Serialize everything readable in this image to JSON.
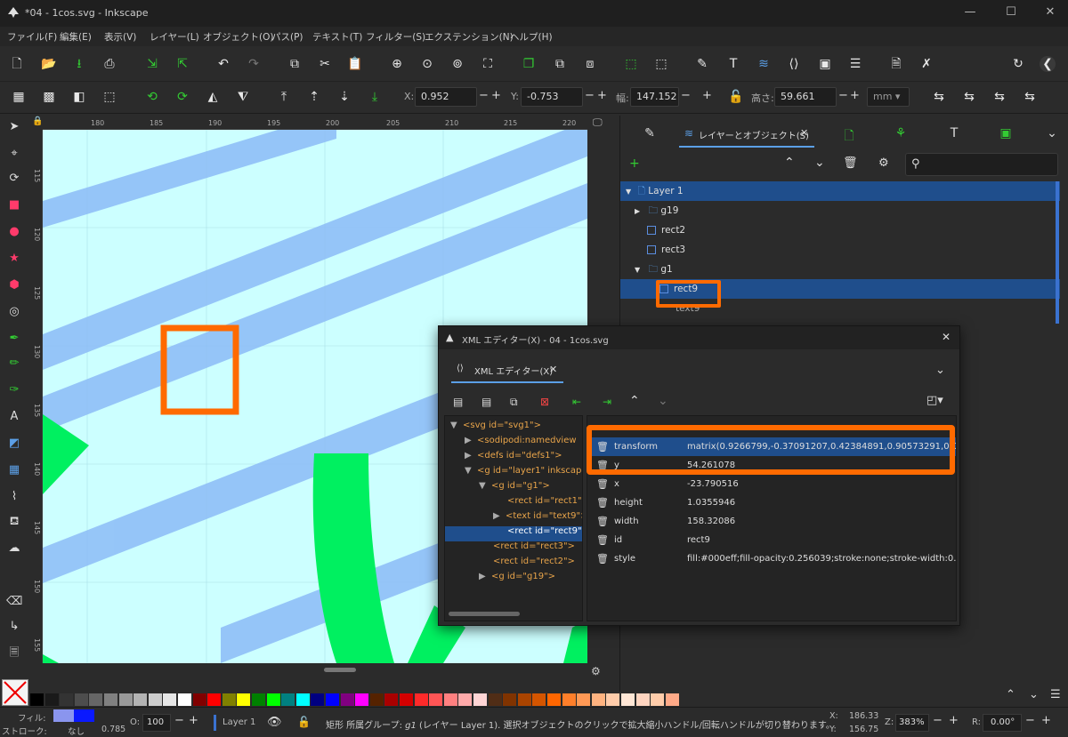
{
  "window": {
    "title": "*04 - 1cos.svg - Inkscape"
  },
  "menu": [
    "ファイル(F)",
    "編集(E)",
    "表示(V)",
    "レイヤー(L)",
    "オブジェクト(O)",
    "パス(P)",
    "テキスト(T)",
    "フィルター(S)",
    "エクステンション(N)",
    "ヘルプ(H)"
  ],
  "controls": {
    "x_label": "X:",
    "x_value": "0.952",
    "y_label": "Y:",
    "y_value": "-0.753",
    "w_label": "幅:",
    "w_value": "147.152",
    "h_label": "高さ:",
    "h_value": "59.661",
    "unit": "mm"
  },
  "ruler": {
    "h": [
      "180",
      "185",
      "190",
      "195",
      "200",
      "205",
      "210",
      "215",
      "220"
    ],
    "v": [
      "115",
      "120",
      "125",
      "130",
      "135",
      "140",
      "145",
      "150",
      "155"
    ]
  },
  "panel": {
    "tab_label": "レイヤーとオブジェクト(S)",
    "layers": [
      {
        "label": "Layer 1",
        "kind": "layer"
      },
      {
        "label": "g19",
        "kind": "group"
      },
      {
        "label": "rect2",
        "kind": "rect"
      },
      {
        "label": "rect3",
        "kind": "rect"
      },
      {
        "label": "g1",
        "kind": "group"
      },
      {
        "label": "rect9",
        "kind": "rect"
      },
      {
        "label": "text9",
        "kind": "text"
      }
    ]
  },
  "xml_editor": {
    "window_title": "XML エディター(X) - 04 - 1cos.svg",
    "tab_label": "XML エディター(X)",
    "tree": [
      {
        "text": "<svg id=\"svg1\">",
        "expander": "▼"
      },
      {
        "text": "<sodipodi:namedview",
        "expander": "▶"
      },
      {
        "text": "<defs id=\"defs1\">",
        "expander": "▶"
      },
      {
        "text": "<g id=\"layer1\" inkscap",
        "expander": "▼"
      },
      {
        "text": "<g id=\"g1\">",
        "expander": "▼"
      },
      {
        "text": "<rect id=\"rect1\">",
        "expander": ""
      },
      {
        "text": "<text id=\"text9\">",
        "expander": "▶"
      },
      {
        "text": "<rect id=\"rect9\">",
        "expander": ""
      },
      {
        "text": "<rect id=\"rect3\">",
        "expander": ""
      },
      {
        "text": "<rect id=\"rect2\">",
        "expander": ""
      },
      {
        "text": "<g id=\"g19\">",
        "expander": "▶"
      }
    ],
    "attributes": [
      {
        "name": "transform",
        "value": "matrix(0.9266799,-0.37091207,0.42384891,0.90573291,0,0)"
      },
      {
        "name": "y",
        "value": "54.261078"
      },
      {
        "name": "x",
        "value": "-23.790516"
      },
      {
        "name": "height",
        "value": "1.0355946"
      },
      {
        "name": "width",
        "value": "158.32086"
      },
      {
        "name": "id",
        "value": "rect9"
      },
      {
        "name": "style",
        "value": "fill:#000eff;fill-opacity:0.256039;stroke:none;stroke-width:0..."
      }
    ]
  },
  "status": {
    "fill_label": "フィル:",
    "stroke_label": "ストローク:",
    "stroke_value": "なし",
    "stroke_width": "0.785",
    "opacity_label": "O:",
    "opacity_value": "100",
    "layer_name": "Layer 1",
    "message_prefix": "矩形  所属グループ: ",
    "message_group": "g1",
    "message_rest": " (レイヤー Layer 1). 選択オブジェクトのクリックで拡大縮小ハンドル/回転ハンドルが切り替わります。",
    "x_label": "X:",
    "x": "186.33",
    "y_label": "Y:",
    "y": "156.75",
    "zoom_label": "Z:",
    "zoom": "383%",
    "rotate_label": "R:",
    "rotate": "0.00°"
  },
  "colors": {
    "accent": "#1f4e8c",
    "highlight": "#ff6a00",
    "canvas": "#ccffff",
    "stripe": "#8cbcf7",
    "green": "#00f060"
  }
}
